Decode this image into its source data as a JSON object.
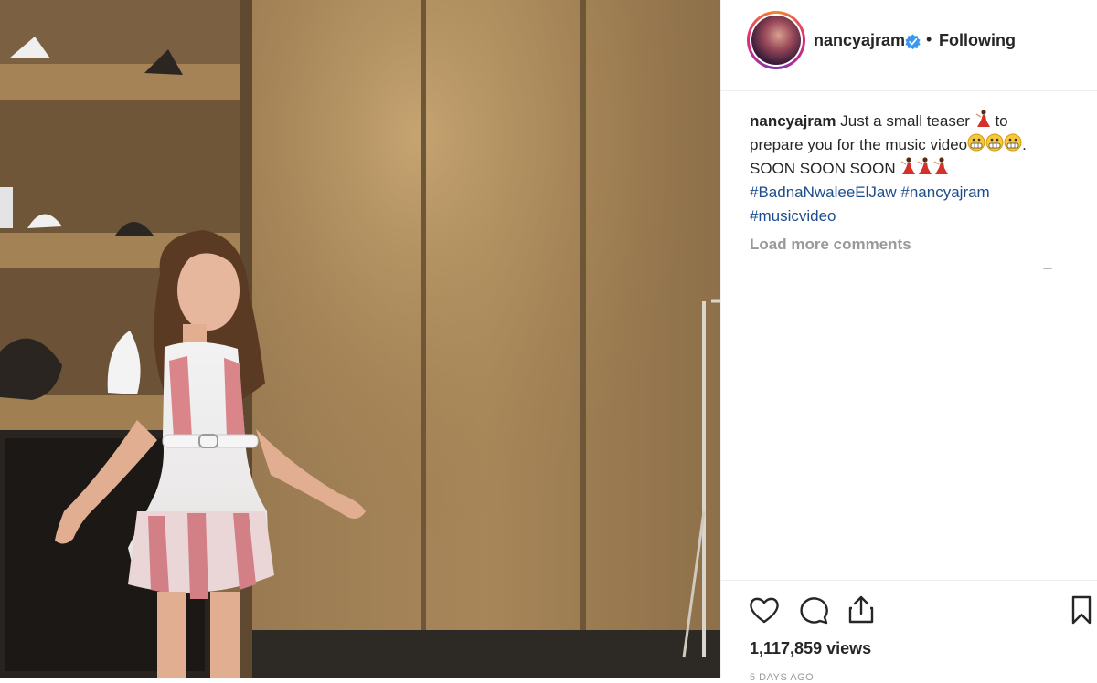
{
  "post": {
    "username": "nancyajram",
    "separator": "•",
    "follow_status": "Following",
    "caption": {
      "username": "nancyajram",
      "line1": "Just a small teaser",
      "line1_end": "to",
      "line2": "prepare you for the music video",
      "line2_end": ".",
      "line3": "SOON SOON SOON",
      "hashtag1": "#BadnaNwaleeElJaw",
      "hashtag2": "#nancyajram",
      "hashtag3": "#musicvideo"
    },
    "load_more_label": "Load more comments",
    "views": "1,117,859 views",
    "timestamp": "5 DAYS AGO"
  },
  "icons": {
    "verified": "verified-badge-icon",
    "like": "heart-icon",
    "comment": "comment-bubble-icon",
    "share": "share-upload-icon",
    "save": "bookmark-icon",
    "dancer": "dancer-emoji",
    "grimace": "grimacing-face-emoji"
  },
  "colors": {
    "text": "#262626",
    "hashtag": "#1e4d8c",
    "muted": "#999999",
    "verified": "#3897f0"
  }
}
